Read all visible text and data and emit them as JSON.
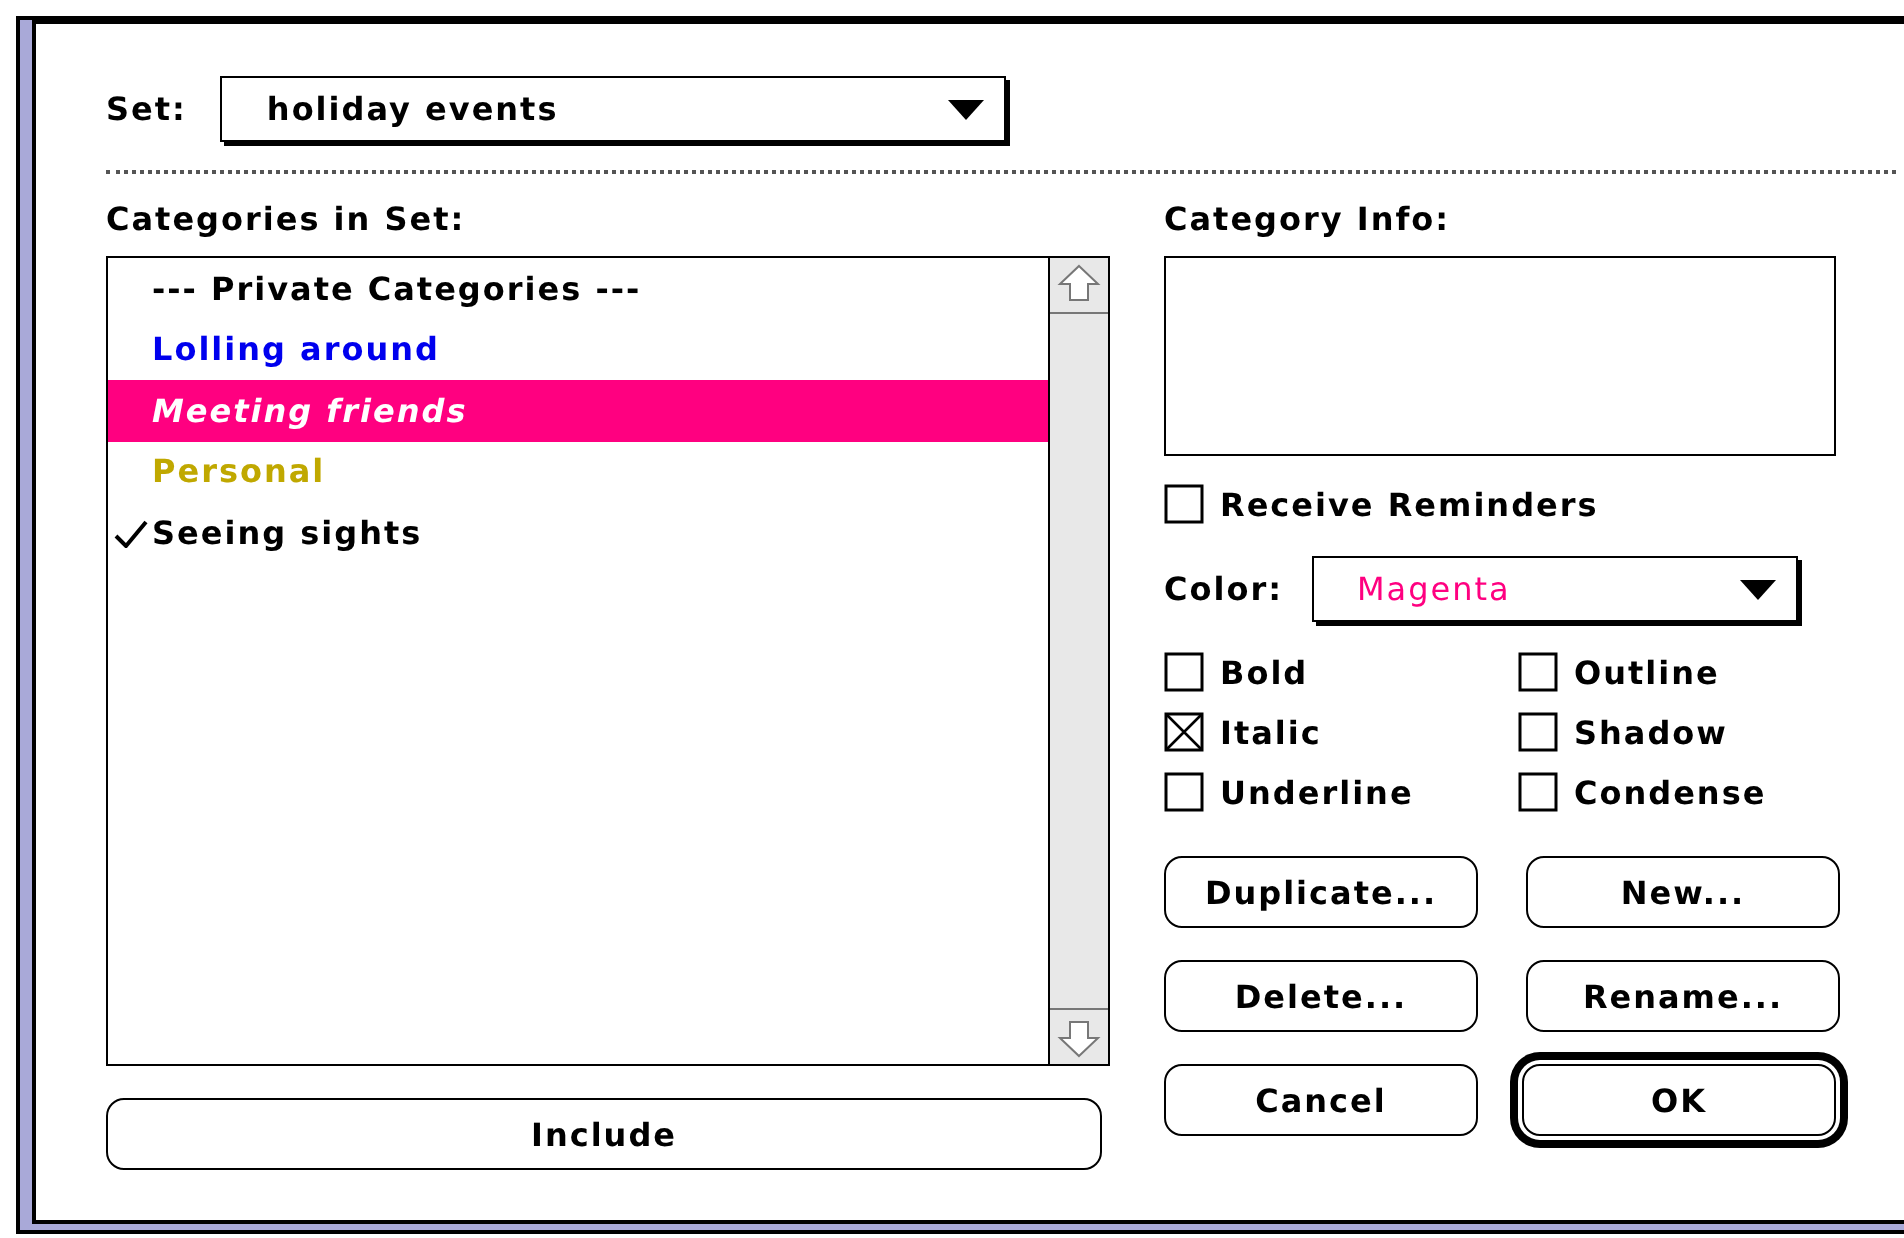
{
  "set": {
    "label": "Set:",
    "value": "holiday events"
  },
  "categories": {
    "label": "Categories in Set:",
    "items": [
      {
        "label": "--- Private Categories ---",
        "color": "#000000",
        "selected": false,
        "checked": false,
        "italic": false
      },
      {
        "label": "Lolling around",
        "color": "#0000ee",
        "selected": false,
        "checked": false,
        "italic": false
      },
      {
        "label": "Meeting friends",
        "color": "#ff0080",
        "selected": true,
        "checked": false,
        "italic": true
      },
      {
        "label": "Personal",
        "color": "#c0a800",
        "selected": false,
        "checked": false,
        "italic": false
      },
      {
        "label": "Seeing sights",
        "color": "#000000",
        "selected": false,
        "checked": true,
        "italic": false
      }
    ]
  },
  "include_button": "Include",
  "info": {
    "label": "Category Info:"
  },
  "reminders": {
    "label": "Receive Reminders",
    "checked": false
  },
  "color": {
    "label": "Color:",
    "value": "Magenta"
  },
  "styles": [
    {
      "label": "Bold",
      "checked": false
    },
    {
      "label": "Outline",
      "checked": false
    },
    {
      "label": "Italic",
      "checked": true
    },
    {
      "label": "Shadow",
      "checked": false
    },
    {
      "label": "Underline",
      "checked": false
    },
    {
      "label": "Condense",
      "checked": false
    }
  ],
  "buttons": [
    {
      "label": "Duplicate...",
      "default": false
    },
    {
      "label": "New...",
      "default": false
    },
    {
      "label": "Delete...",
      "default": false
    },
    {
      "label": "Rename...",
      "default": false
    },
    {
      "label": "Cancel",
      "default": false
    },
    {
      "label": "OK",
      "default": true
    }
  ]
}
